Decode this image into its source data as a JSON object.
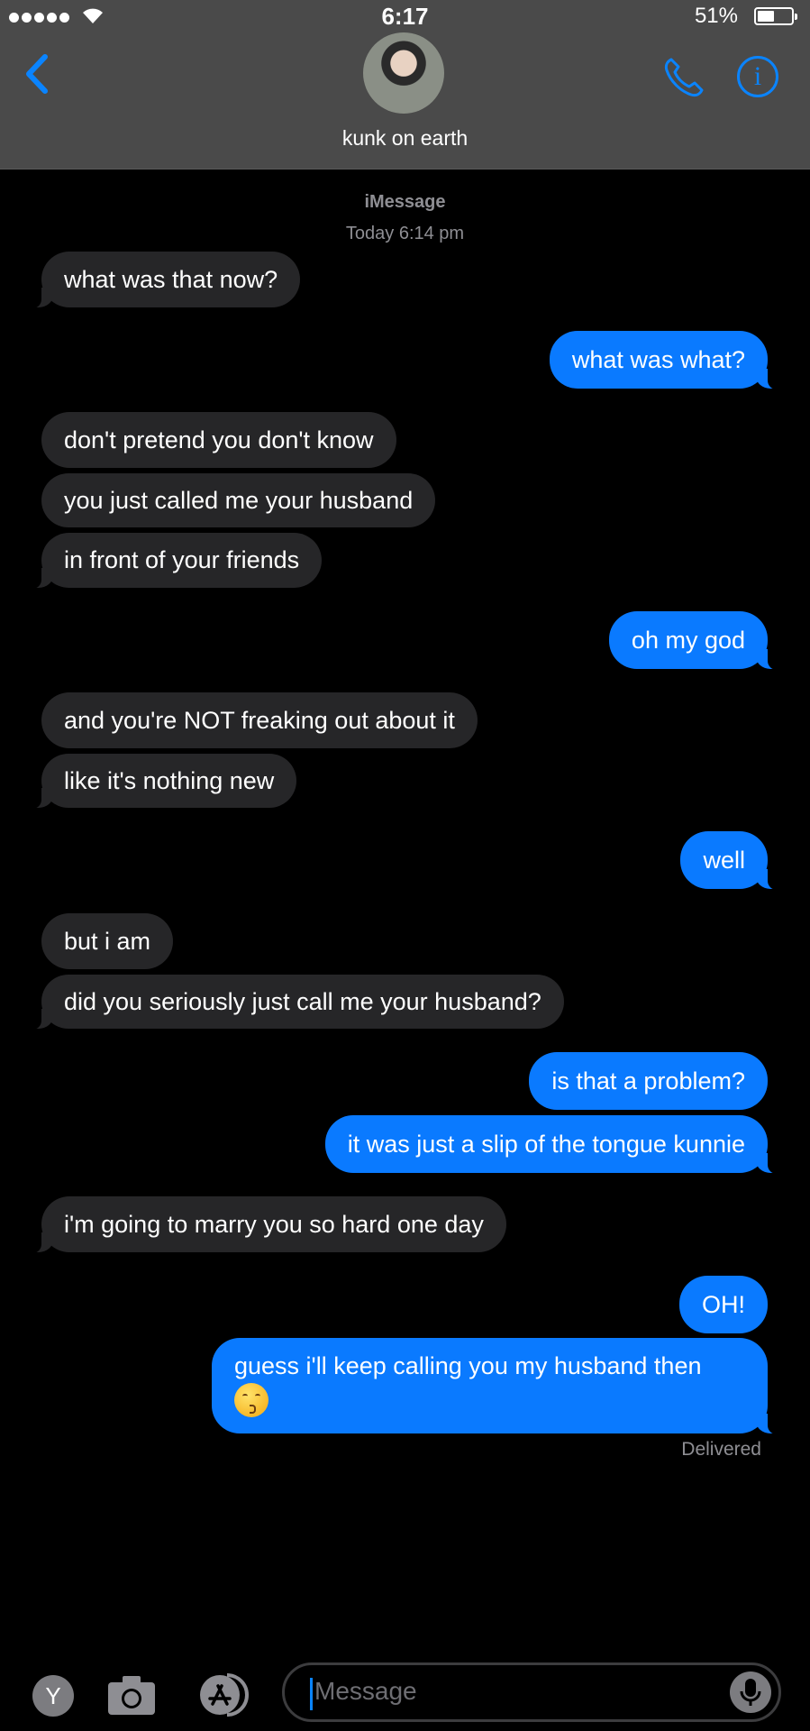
{
  "status_bar": {
    "time": "6:17",
    "battery": "51%",
    "battery_level": 0.51
  },
  "header": {
    "contact_name": "kunk on earth"
  },
  "thread": {
    "service": "iMessage",
    "timestamp": "Today 6:14 pm",
    "messages": [
      {
        "from": "them",
        "text": "what was that now?"
      },
      {
        "from": "me",
        "text": "what was what?"
      },
      {
        "from": "them",
        "text": "don't pretend you don't know"
      },
      {
        "from": "them",
        "text": "you just called me your husband"
      },
      {
        "from": "them",
        "text": "in front of your friends"
      },
      {
        "from": "me",
        "text": "oh my god"
      },
      {
        "from": "them",
        "text": "and you're NOT freaking out about it"
      },
      {
        "from": "them",
        "text": "like it's nothing new"
      },
      {
        "from": "me",
        "text": "well"
      },
      {
        "from": "them",
        "text": "but i am"
      },
      {
        "from": "them",
        "text": "did you seriously just call me your husband?"
      },
      {
        "from": "me",
        "text": "is that a problem?"
      },
      {
        "from": "me",
        "text": "it was just a slip of the tongue kunnie"
      },
      {
        "from": "them",
        "text": "i'm going to marry you so hard one day"
      },
      {
        "from": "me",
        "text": "OH!"
      },
      {
        "from": "me",
        "text": "guess i'll keep calling you my husband then",
        "emoji": "kissing-face"
      }
    ],
    "delivered": "Delivered"
  },
  "input_bar": {
    "placeholder": "Message",
    "apps_button_label": "Y"
  },
  "colors": {
    "outgoing": "#0a7aff",
    "incoming": "#262628",
    "accent": "#0a84ff",
    "header": "#4a4a4a"
  }
}
